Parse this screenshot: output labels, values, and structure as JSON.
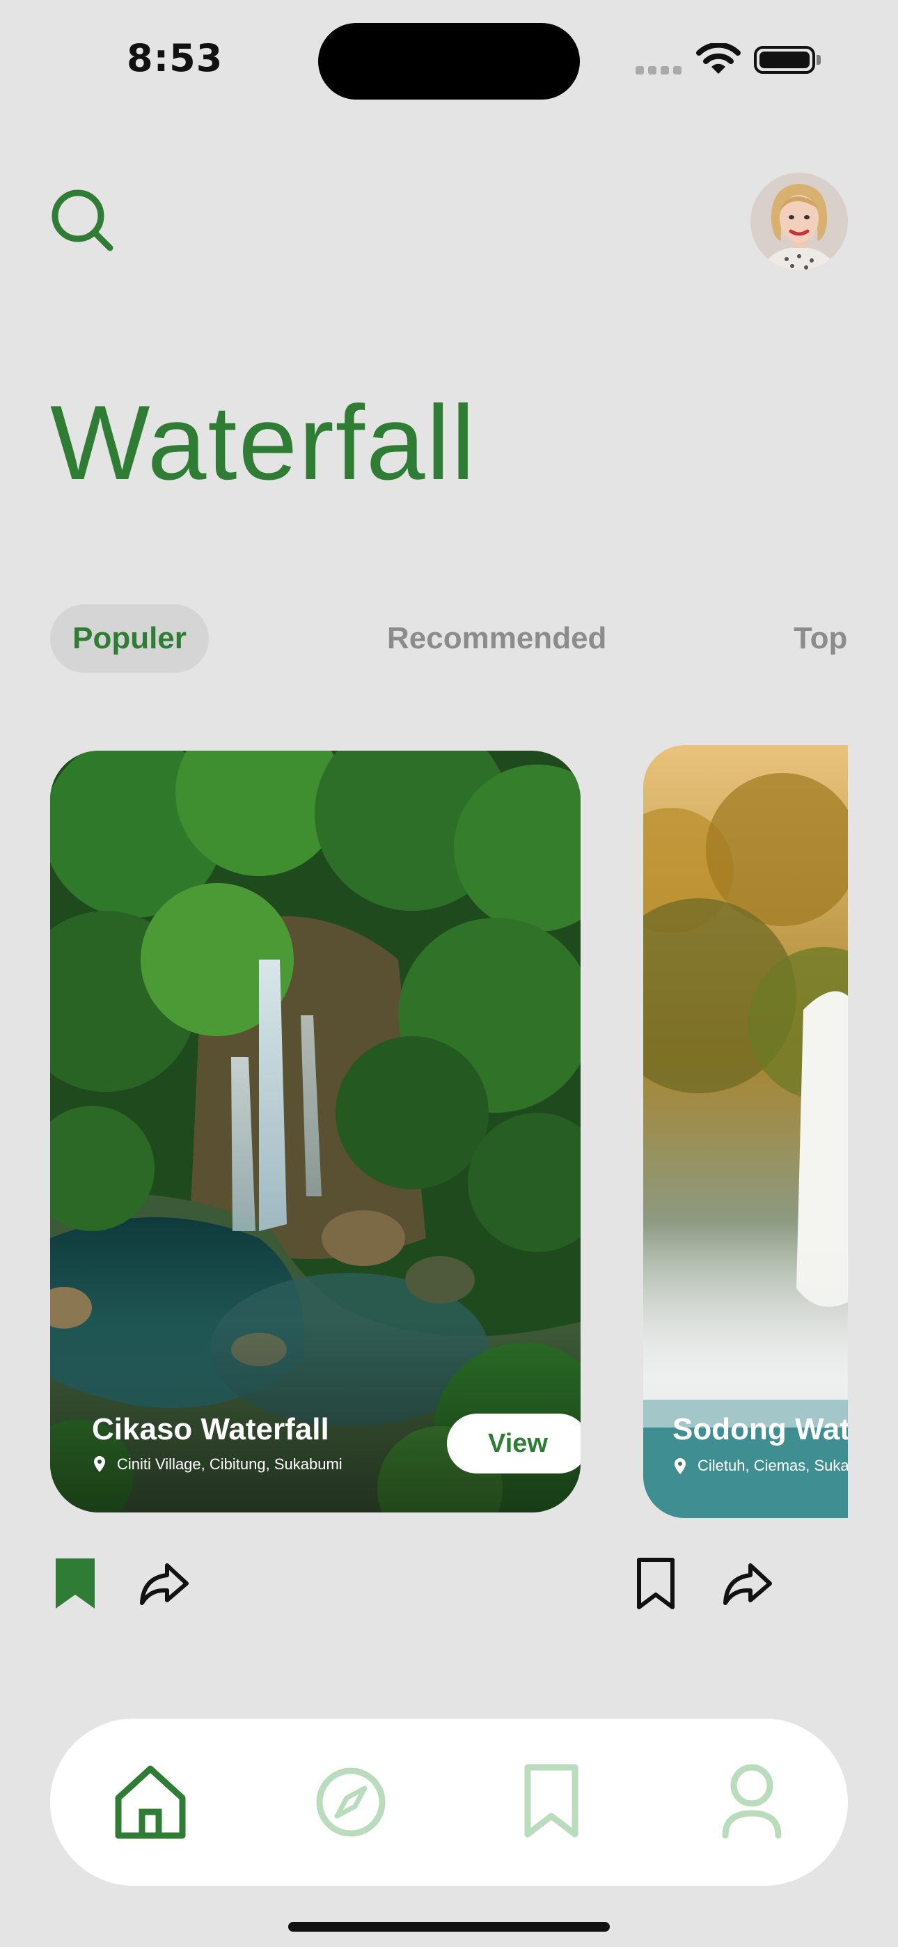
{
  "status_bar": {
    "time": "8:53"
  },
  "header": {
    "title": "Waterfall"
  },
  "tabs": [
    {
      "label": "Populer",
      "active": true
    },
    {
      "label": "Recommended",
      "active": false
    },
    {
      "label": "Top",
      "active": false
    }
  ],
  "cards": [
    {
      "title": "Cikaso Waterfall",
      "location": "Ciniti Village, Cibitung, Sukabumi",
      "view_label": "View",
      "bookmarked": true
    },
    {
      "title": "Sodong Waterfall",
      "location": "Ciletuh, Ciemas, Sukabumi",
      "bookmarked": false
    }
  ],
  "nav": {
    "items": [
      "home-icon",
      "compass-icon",
      "bookmark-icon",
      "profile-icon"
    ],
    "active": "home-icon"
  },
  "colors": {
    "accent": "#2f7d35",
    "background": "#e4e4e4",
    "nav_inactive": "#b9dcbc"
  }
}
